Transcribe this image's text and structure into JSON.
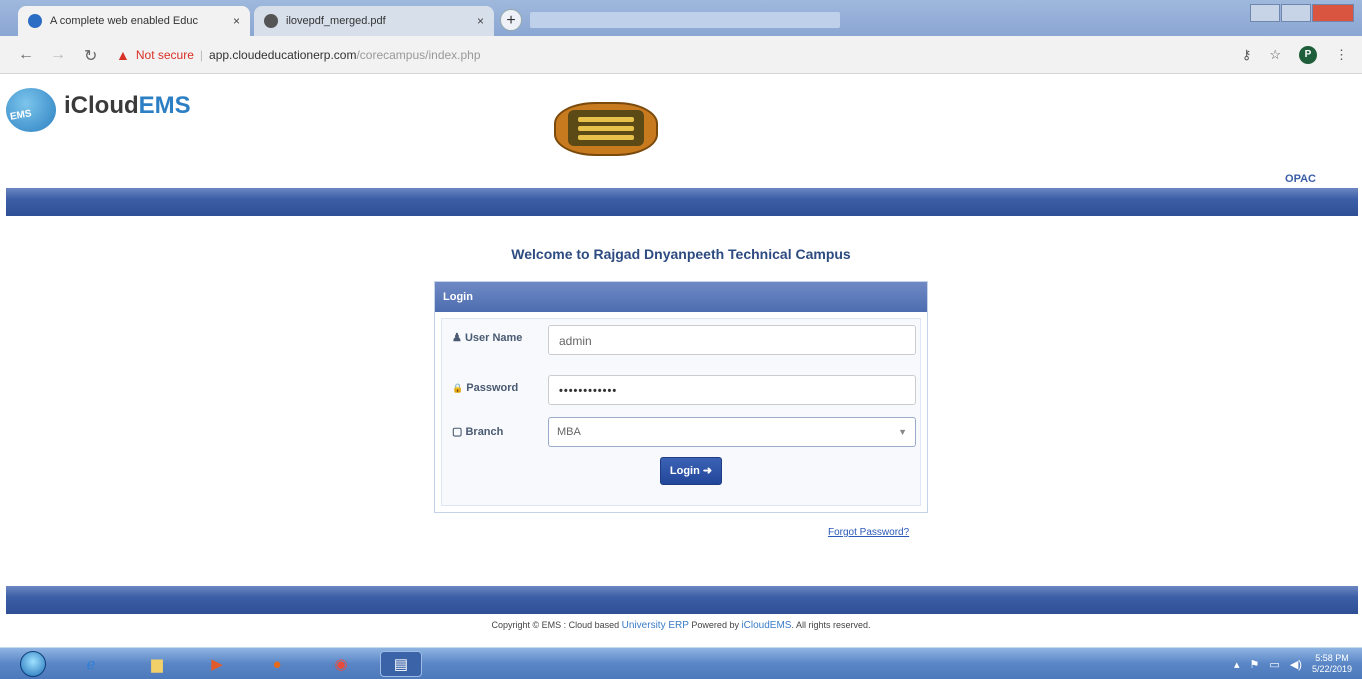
{
  "browser": {
    "tabs": [
      {
        "title": "A complete web enabled Educa",
        "close": "×"
      },
      {
        "title": "ilovepdf_merged.pdf",
        "close": "×"
      }
    ],
    "new_tab": "+",
    "security_label": "Not secure",
    "url_host": "app.cloudeducationerp.com",
    "url_path": "/corecampus/index.php",
    "profile_initial": "P"
  },
  "header": {
    "logo_prefix": "iCloud",
    "logo_suffix": "EMS",
    "logo_badge": "EMS",
    "opac_link": "OPAC"
  },
  "main": {
    "welcome": "Welcome to Rajgad Dnyanpeeth Technical Campus",
    "login_panel": {
      "title": "Login",
      "username_label_icon": "♟",
      "username_label": "User Name",
      "username_value": "admin",
      "password_label_icon": "🔒",
      "password_label": "Password",
      "password_value": "••••••••••••",
      "branch_label_icon": "▢",
      "branch_label": "Branch",
      "branch_value": "MBA",
      "login_button": "Login ➜"
    },
    "forgot_password": "Forgot Password?"
  },
  "footer": {
    "text_a": "Copyright © EMS : Cloud based ",
    "link_a": "University ERP",
    "text_b": " Powered by ",
    "link_b": "iCloudEMS",
    "text_c": ". All rights reserved."
  },
  "taskbar": {
    "time": "5:58 PM",
    "date": "5/22/2019"
  }
}
